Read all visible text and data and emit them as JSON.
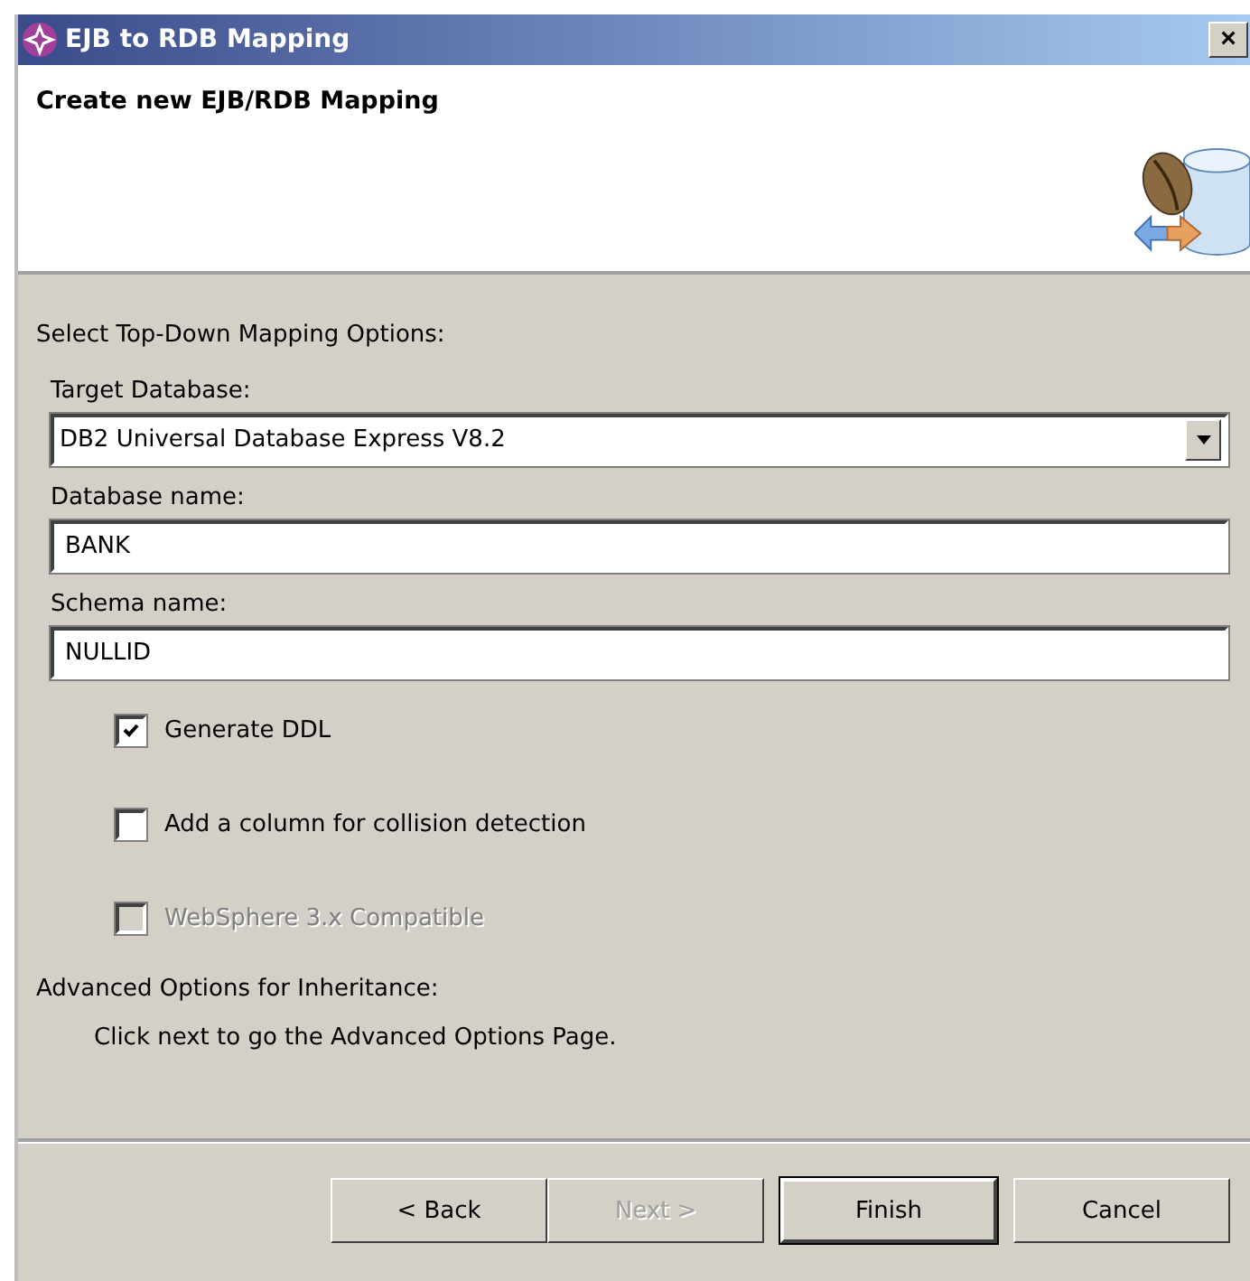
{
  "window": {
    "title": "EJB to RDB Mapping",
    "close": "×"
  },
  "header": {
    "title": "Create new EJB/RDB Mapping"
  },
  "section_label": "Select Top-Down Mapping Options:",
  "fields": [
    {
      "kind": "dropdown",
      "label": "Target Database:",
      "value": "DB2 Universal Database Express V8.2"
    },
    {
      "kind": "text",
      "label": "Database name:",
      "value": "BANK"
    },
    {
      "kind": "text",
      "label": "Schema name:",
      "value": "NULLID"
    }
  ],
  "checkboxes": [
    {
      "label": "Generate DDL",
      "checked": true,
      "disabled": false
    },
    {
      "label": "Add a column for collision detection",
      "checked": false,
      "disabled": false
    },
    {
      "label": "WebSphere 3.x Compatible",
      "checked": false,
      "disabled": true
    }
  ],
  "advanced": {
    "label": "Advanced Options for Inheritance:",
    "hint": "Click next to go the Advanced Options Page."
  },
  "buttons": [
    {
      "label": "< Back",
      "disabled": false,
      "default": false
    },
    {
      "label": "Next >",
      "disabled": true,
      "default": false
    },
    {
      "label": "Finish",
      "disabled": false,
      "default": true
    },
    {
      "label": "Cancel",
      "disabled": false,
      "default": false
    }
  ]
}
